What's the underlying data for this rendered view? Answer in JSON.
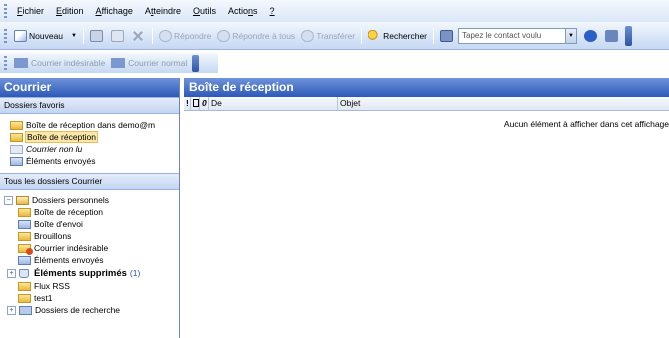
{
  "menu": {
    "items": [
      {
        "u": "F",
        "rest": "ichier"
      },
      {
        "u": "E",
        "rest": "dition"
      },
      {
        "u": "A",
        "rest": "ffichage"
      },
      {
        "pre": "A",
        "u": "t",
        "rest": "teindre"
      },
      {
        "u": "O",
        "rest": "utils"
      },
      {
        "pre": "Actio",
        "u": "n",
        "rest": "s"
      },
      {
        "u": "?",
        "rest": ""
      }
    ]
  },
  "toolbar": {
    "new_label": "Nouveau",
    "reply": "Répondre",
    "reply_all": "Répondre à tous",
    "forward": "Transférer",
    "search": "Rechercher",
    "contact_placeholder": "Tapez le contact voulu"
  },
  "toolbar2": {
    "junk": "Courrier indésirable",
    "normal": "Courrier normal"
  },
  "nav": {
    "title": "Courrier",
    "favorites_header": "Dossiers favoris",
    "favorites": [
      {
        "label": "Boîte de réception dans demo@m",
        "icon": "inbox-folder-icon",
        "style": ""
      },
      {
        "label": "Boîte de réception",
        "icon": "inbox-folder-icon",
        "style": "selected"
      },
      {
        "label": "Courrier non lu",
        "icon": "unread-folder-icon",
        "style": "italic"
      },
      {
        "label": "Éléments envoyés",
        "icon": "sent-folder-icon",
        "style": ""
      }
    ],
    "all_header": "Tous les dossiers Courrier",
    "root": "Dossiers personnels",
    "tree": [
      {
        "label": "Boîte de réception",
        "icon": "inbox-folder-icon"
      },
      {
        "label": "Boîte d'envoi",
        "icon": "outbox-folder-icon"
      },
      {
        "label": "Brouillons",
        "icon": "drafts-folder-icon"
      },
      {
        "label": "Courrier indésirable",
        "icon": "junk-folder-icon"
      },
      {
        "label": "Éléments envoyés",
        "icon": "sent-folder-icon"
      }
    ],
    "deleted": {
      "label": "Éléments supprimés",
      "count": "(1)"
    },
    "tree2": [
      {
        "label": "Flux RSS",
        "icon": "rss-folder-icon"
      },
      {
        "label": "test1",
        "icon": "folder-icon"
      }
    ],
    "search_folders": "Dossiers de recherche"
  },
  "content": {
    "title": "Boîte de réception",
    "columns": {
      "importance": "!",
      "from": "De",
      "subject": "Objet"
    },
    "empty_message": "Aucun élément à afficher dans cet affichage"
  },
  "colors": {
    "header_blue": "#2c58b8",
    "selection": "#fbe8a8"
  }
}
